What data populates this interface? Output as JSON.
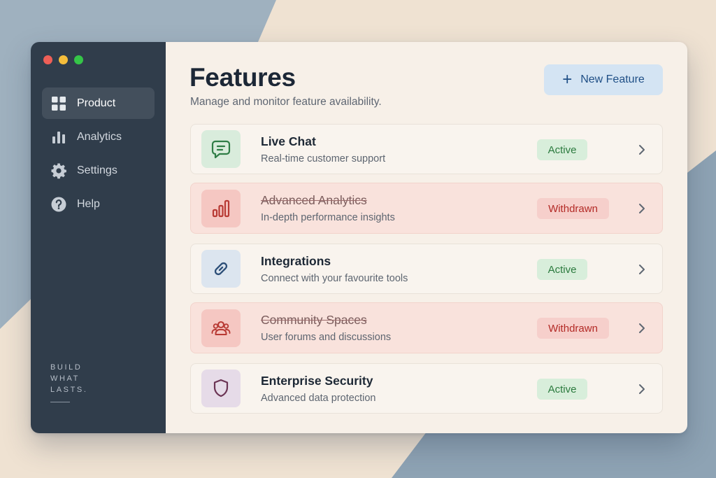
{
  "window": {
    "traffic_lights": [
      "#ee5f57",
      "#f4bd3b",
      "#35c548"
    ]
  },
  "sidebar": {
    "items": [
      {
        "label": "Product",
        "icon": "grid-icon",
        "active": true
      },
      {
        "label": "Analytics",
        "icon": "bar-chart-icon",
        "active": false
      },
      {
        "label": "Settings",
        "icon": "gear-icon",
        "active": false
      },
      {
        "label": "Help",
        "icon": "help-circle-icon",
        "active": false
      }
    ],
    "tagline": [
      "BUILD",
      "WHAT",
      "LASTS."
    ]
  },
  "header": {
    "title": "Features",
    "subtitle": "Manage and monitor feature availability.",
    "new_button_label": "New Feature"
  },
  "features": [
    {
      "title": "Live Chat",
      "description": "Real-time customer support",
      "status": "Active",
      "icon": "chat-icon"
    },
    {
      "title": "Advanced Analytics",
      "description": "In-depth performance insights",
      "status": "Withdrawn",
      "icon": "bar-chart-icon"
    },
    {
      "title": "Integrations",
      "description": "Connect with your favourite tools",
      "status": "Active",
      "icon": "link-icon"
    },
    {
      "title": "Community Spaces",
      "description": "User forums and discussions",
      "status": "Withdrawn",
      "icon": "users-icon"
    },
    {
      "title": "Enterprise Security",
      "description": "Advanced data protection",
      "status": "Active",
      "icon": "shield-icon"
    }
  ],
  "colors": {
    "sidebar_bg": "#303d4b",
    "accent_blue": "#1f4f86",
    "active_green": "#2b7a3e",
    "withdrawn_red": "#b32a26"
  }
}
